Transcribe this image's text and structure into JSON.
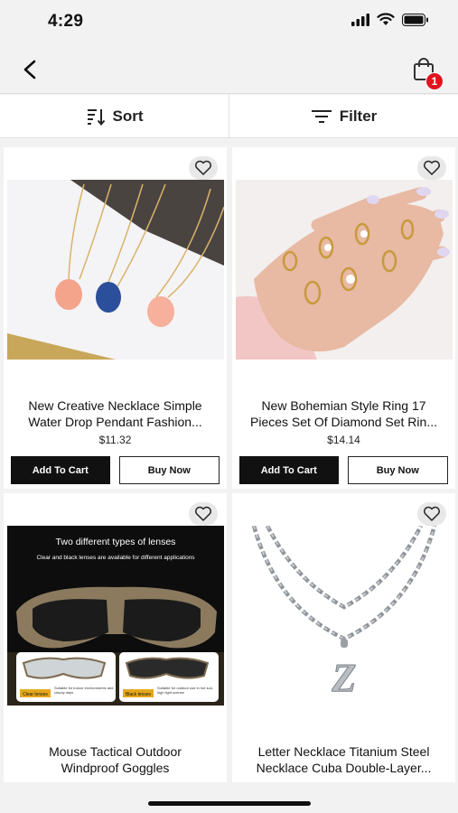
{
  "status": {
    "time": "4:29"
  },
  "nav": {
    "bag_count": "1"
  },
  "toolbar": {
    "sort_label": "Sort",
    "filter_label": "Filter"
  },
  "products": [
    {
      "title_line1": "New Creative Necklace Simple",
      "title_line2": "Water Drop Pendant Fashion...",
      "price": "$11.32",
      "add_label": "Add To Cart",
      "buy_label": "Buy Now"
    },
    {
      "title_line1": "New Bohemian Style Ring 17",
      "title_line2": "Pieces Set Of Diamond Set Rin...",
      "price": "$14.14",
      "add_label": "Add To Cart",
      "buy_label": "Buy Now"
    },
    {
      "title_line1": "Mouse Tactical Outdoor",
      "title_line2": "Windproof Goggles",
      "img_heading": "Two different types of lenses",
      "img_sub": "Clear and black lenses are available for different applications",
      "clear_tag": "Clear lenses",
      "clear_desc": "Suitable for indoor environments and cloudy days",
      "black_tag": "Black lenses",
      "black_desc": "Suitable for outdoor use in hot sun, high light scenes"
    },
    {
      "title_line1": "Letter Necklace Titanium Steel",
      "title_line2": "Necklace Cuba Double-Layer..."
    }
  ]
}
